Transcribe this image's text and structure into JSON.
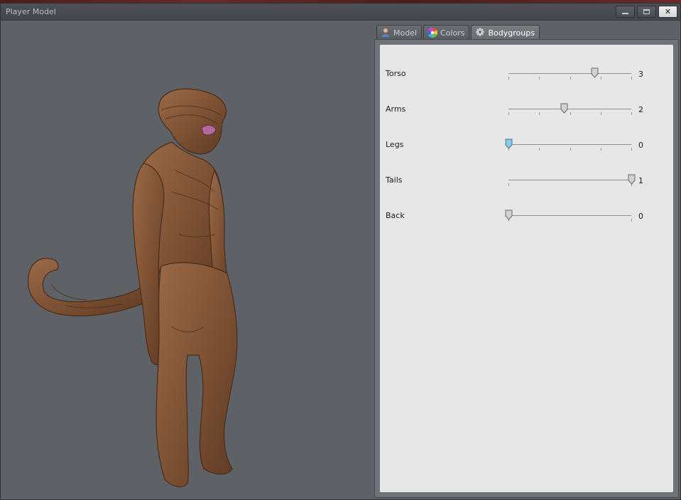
{
  "window": {
    "title": "Player Model",
    "controls": {
      "minimize": "minimize-icon",
      "maximize": "maximize-icon",
      "close": "✕"
    }
  },
  "tabs": [
    {
      "label": "Model",
      "icon": "person-icon",
      "active": false
    },
    {
      "label": "Colors",
      "icon": "color-wheel-icon",
      "active": false
    },
    {
      "label": "Bodygroups",
      "icon": "gear-icon",
      "active": true
    }
  ],
  "bodygroups": [
    {
      "label": "Torso",
      "value": "3",
      "level": 0.7,
      "selected": false
    },
    {
      "label": "Arms",
      "value": "2",
      "level": 0.45,
      "selected": false
    },
    {
      "label": "Legs",
      "value": "0",
      "level": 0.0,
      "selected": true
    },
    {
      "label": "Tails",
      "value": "1",
      "level": 1.0,
      "selected": false
    },
    {
      "label": "Back",
      "value": "0",
      "level": 0.0,
      "selected": false
    }
  ],
  "colors": {
    "panel_bg": "#e7e7e7",
    "viewport_bg": "#5e6166",
    "knob_selected": "#8fc6df",
    "knob_default": "#d2d2d2",
    "model_skin": "#8a5a3c"
  }
}
